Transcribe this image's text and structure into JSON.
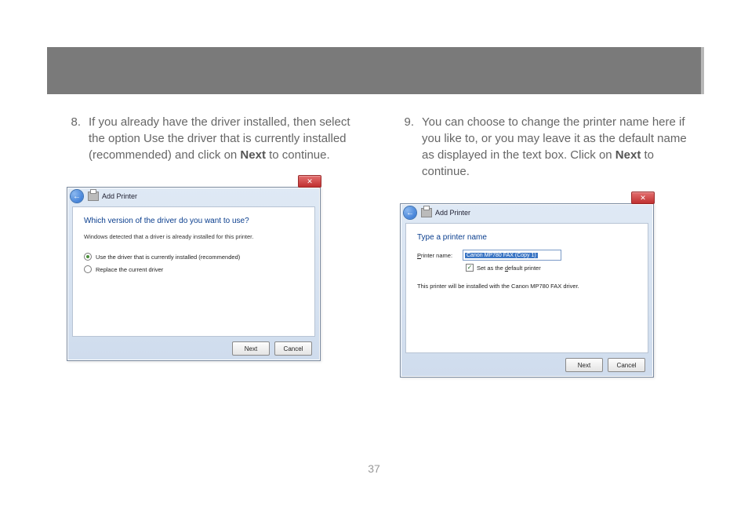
{
  "pageNumber": "37",
  "left": {
    "num": "8.",
    "text_a": "If you already have the driver installed, then select the option Use the driver that is currently installed (recommended) and click on ",
    "bold": "Next",
    "text_b": " to continue.",
    "win": {
      "title": "Add Printer",
      "heading": "Which version of the driver do you want to use?",
      "sub": "Windows detected that a driver is already installed for this printer.",
      "opt1": "Use the driver that is currently installed (recommended)",
      "opt2": "Replace the current driver",
      "next": "Next",
      "cancel": "Cancel"
    }
  },
  "right": {
    "num": "9.",
    "text_a": "You can choose to change the printer name here if you like to, or you may leave it as the default name as displayed in the text box. Click on ",
    "bold": "Next",
    "text_b": " to continue.",
    "win": {
      "title": "Add Printer",
      "heading": "Type a printer name",
      "label_pre": "P",
      "label_post": "rinter name:",
      "value": "Canon MP780 FAX (Copy 1)",
      "chk_pre": "Set as the ",
      "chk_u": "d",
      "chk_post": "efault printer",
      "note": "This printer will be installed with the Canon MP780 FAX driver.",
      "next": "Next",
      "cancel": "Cancel"
    }
  }
}
